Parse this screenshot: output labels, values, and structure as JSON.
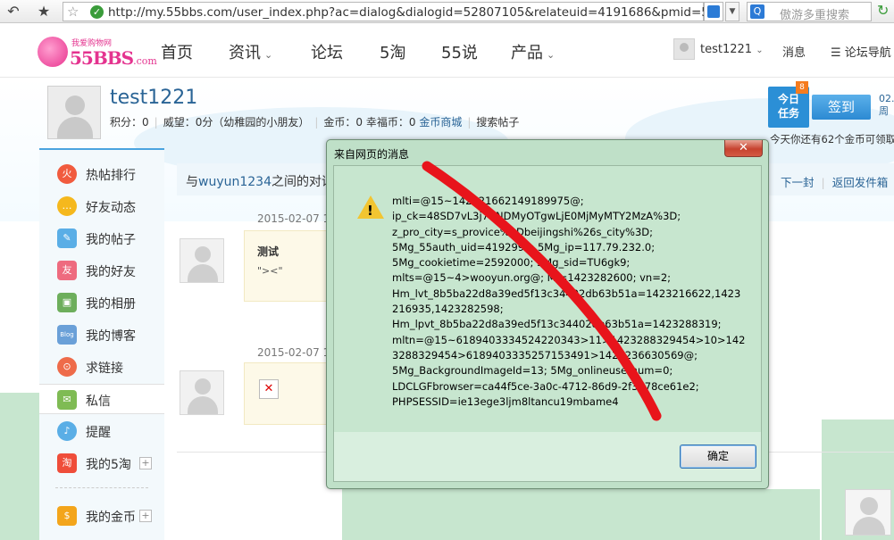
{
  "browser": {
    "url": "http://my.55bbs.com/user_index.php?ac=dialog&dialogid=52807105&relateuid=4191686&pmid=52",
    "search_placeholder": "傲游多重搜索",
    "search_logo": "Q"
  },
  "site": {
    "logo_tagline": "我爱购物网",
    "logo_main": "55BBS",
    "logo_suffix": ".com",
    "nav": [
      {
        "label": "首页"
      },
      {
        "label": "资讯"
      },
      {
        "label": "论坛"
      },
      {
        "label": "5淘"
      },
      {
        "label": "55说"
      },
      {
        "label": "产品"
      }
    ],
    "username": "test1221",
    "messages_label": "消息",
    "forum_nav_label": "论坛导航"
  },
  "profile": {
    "name": "test1221",
    "points": "积分：0",
    "prestige": "威望：0分（幼稚园的小朋友）",
    "gold": "金币：0",
    "fortune": "幸福币：0",
    "gold_mall": "金币商城",
    "search_posts": "搜索帖子"
  },
  "task": {
    "label_line1": "今日",
    "label_line2": "任务",
    "badge": "8",
    "signin_label": "签到",
    "date_line1": "02.",
    "date_line2": "周",
    "tip": "今天你还有62个金币可领取"
  },
  "sidebar": {
    "items": [
      {
        "label": "热帖排行",
        "icon_glyph": "火",
        "color": "#f15b3e"
      },
      {
        "label": "好友动态",
        "icon_glyph": "…",
        "color": "#f5b81d"
      },
      {
        "label": "我的帖子",
        "icon_glyph": "✎",
        "color": "#5aaee6"
      },
      {
        "label": "我的好友",
        "icon_glyph": "友",
        "color": "#ee6b7f"
      },
      {
        "label": "我的相册",
        "icon_glyph": "▣",
        "color": "#6dae5c"
      },
      {
        "label": "我的博客",
        "icon_glyph": "Blog",
        "color": "#6aa0d8"
      },
      {
        "label": "求链接",
        "icon_glyph": "⊙",
        "color": "#ee6b4a"
      },
      {
        "label": "私信",
        "icon_glyph": "✉",
        "color": "#7fbb54"
      },
      {
        "label": "提醒",
        "icon_glyph": "♪",
        "color": "#5aaee6"
      },
      {
        "label": "我的5淘",
        "icon_glyph": "淘",
        "color": "#ef4d3a"
      },
      {
        "label": "我的金币",
        "icon_glyph": "$",
        "color": "#f3a51b"
      }
    ],
    "plus": "+"
  },
  "conversation": {
    "title_prefix": "与",
    "title_user": "wuyun1234",
    "title_suffix": "之间的对话",
    "next_label": "下一封",
    "back_label": "返回发件箱",
    "messages": [
      {
        "time": "2015-02-07 13",
        "title": "测试",
        "body": "\"><\""
      },
      {
        "time": "2015-02-07 13"
      }
    ]
  },
  "dialog": {
    "title": "来自网页的消息",
    "close_label": "✕",
    "warning_icon": "warning-icon",
    "lines": [
      "mlti=@15~142321662149189975@;",
      "ip_ck=48SD7vL3j7CNDMyOTgwLjE0MjMyMTY2MzA%3D;",
      "z_pro_city=s_provice%3Dbeijingshi%26s_city%3D;",
      "5Mg_55auth_uid=4192995; 5Mg_ip=117.79.232.0;",
      "5Mg_cookietime=2592000; 5Mg_sid=TU6gk9;",
      "mlts=@15~4>wooyun.org@; Ml=1423282600; vn=2;",
      "Hm_lvt_8b5ba22d8a39ed5f13c34402db63b51a=1423216622,1423",
      "216935,1423282598;",
      "Hm_lpvt_8b5ba22d8a39ed5f13c34402db63b51a=1423288319;",
      "mltn=@15~6189403334524220343>11>1423288329454>10>142",
      "3288329454>6189403335257153491>1423236630569@;",
      "5Mg_BackgroundImageId=13; 5Mg_onlineusernum=0;",
      "LDCLGFbrowser=ca44f5ce-3a0c-4712-86d9-2f3878ce61e2;",
      "PHPSESSID=ie13ege3ljm8ltancu19mbame4"
    ],
    "ok_label": "确定"
  },
  "colors": {
    "accent_blue": "#2a6496",
    "brand_pink": "#e4338f",
    "annotation_red": "#e8141b"
  }
}
